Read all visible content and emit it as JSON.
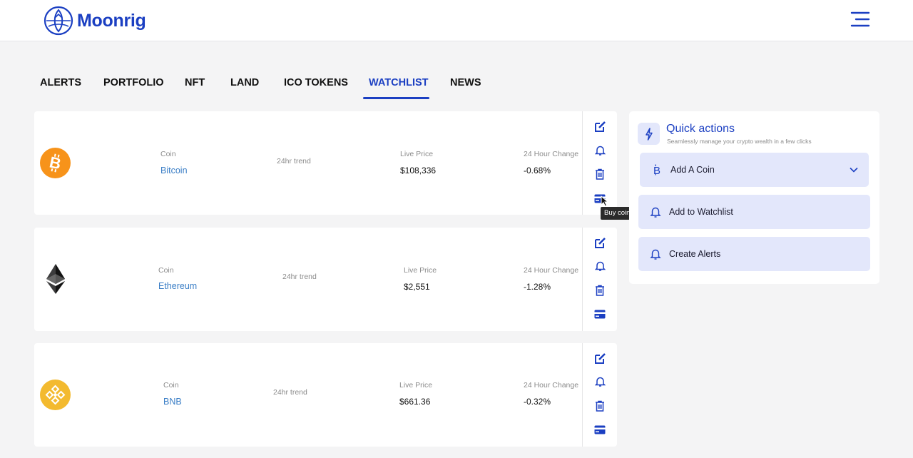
{
  "brand": {
    "name": "Moonrig"
  },
  "nav": {
    "tabs": [
      {
        "label": "ALERTS"
      },
      {
        "label": "PORTFOLIO"
      },
      {
        "label": "NFT"
      },
      {
        "label": "LAND"
      },
      {
        "label": "ICO TOKENS"
      },
      {
        "label": "WATCHLIST",
        "active": true
      },
      {
        "label": "NEWS"
      }
    ]
  },
  "watchlist": {
    "rows": [
      {
        "coin_label": "Coin",
        "coin": "Bitcoin",
        "trend_label": "24hr trend",
        "price_label": "Live Price",
        "price": "$108,336",
        "change_label": "24 Hour Change",
        "change": "-0.68%",
        "icon": "bitcoin-logo"
      },
      {
        "coin_label": "Coin",
        "coin": "Ethereum",
        "trend_label": "24hr trend",
        "price_label": "Live Price",
        "price": "$2,551",
        "change_label": "24 Hour Change",
        "change": "-1.28%",
        "icon": "ethereum-logo"
      },
      {
        "coin_label": "Coin",
        "coin": "BNB",
        "trend_label": "24hr trend",
        "price_label": "Live Price",
        "price": "$661.36",
        "change_label": "24 Hour Change",
        "change": "-0.32%",
        "icon": "bnb-logo"
      }
    ],
    "row_actions": [
      "edit-icon",
      "bell-icon",
      "trash-icon",
      "credit-card-icon"
    ],
    "tooltip": "Buy coin"
  },
  "quick_actions": {
    "title": "Quick actions",
    "subtitle": "Seamlessly manage your crypto wealth in a few clicks",
    "items": [
      {
        "label": "Add A Coin",
        "icon": "bitcoin-b-icon",
        "has_dropdown": true
      },
      {
        "label": "Add to Watchlist",
        "icon": "bell-icon"
      },
      {
        "label": "Create Alerts",
        "icon": "bell-icon"
      }
    ]
  },
  "colors": {
    "primary": "#1b3fc2",
    "coin_link": "#3a7ec6",
    "panel_button_bg": "#e3e7fb",
    "background": "#f4f4f5",
    "bitcoin": "#f7931a",
    "bnb": "#f3ba2f"
  }
}
